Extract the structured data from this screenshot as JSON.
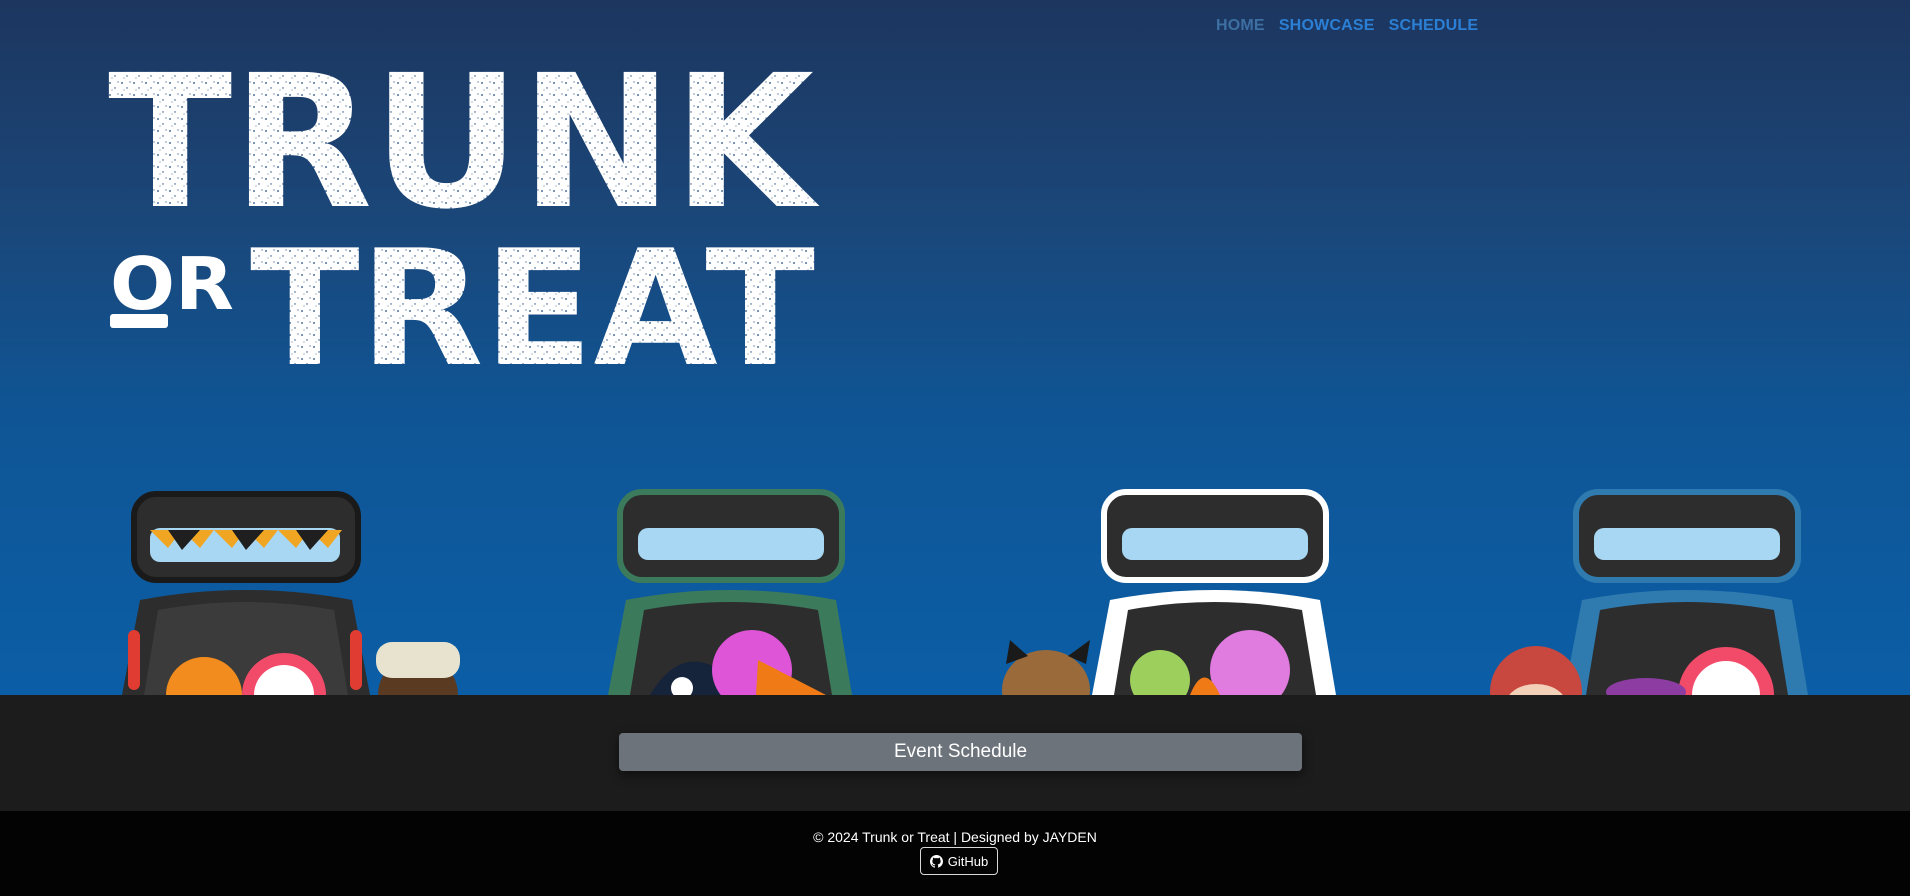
{
  "nav": {
    "items": [
      {
        "label": "HOME",
        "active": true
      },
      {
        "label": "SHOWCASE",
        "active": false
      },
      {
        "label": "SCHEDULE",
        "active": false
      }
    ]
  },
  "logo": {
    "line1": "TRUNK",
    "or": "OR",
    "line2": "TREAT"
  },
  "main": {
    "schedule_button": "Event Schedule"
  },
  "footer": {
    "copyright": "© 2024 Trunk or Treat | Designed by JAYDEN",
    "github_label": "GitHub"
  },
  "colors": {
    "nav_link": "#2b7fd4",
    "nav_active": "#3d6fa3",
    "button_bg": "#6c737a",
    "band_bg": "#1c1c1c",
    "footer_bg": "#030303"
  }
}
